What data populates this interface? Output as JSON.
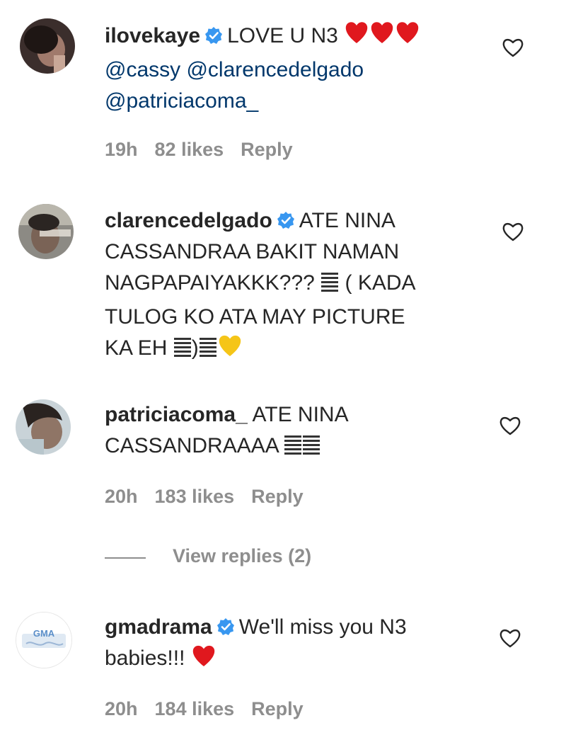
{
  "comments": [
    {
      "username": "ilovekaye",
      "verified": true,
      "text_line1": "LOVE U N3",
      "mentions_line2": "@cassy @clarencedelgado",
      "mentions_line3": "@patriciacoma_",
      "time": "19h",
      "likes": "82 likes",
      "reply": "Reply",
      "emoji": "hearts"
    },
    {
      "username": "clarencedelgado",
      "verified": true,
      "line1": "ATE NINA",
      "line2": "CASSANDRAA BAKIT NAMAN",
      "line3a": "NAGPAPAIYAKKK???",
      "line3b": "( KADA",
      "line4": "TULOG KO ATA MAY PICTURE",
      "line5a": "KA EH",
      "line5b": ")"
    },
    {
      "username": "patriciacoma_",
      "verified": false,
      "line1": "ATE NINA",
      "line2": "CASSANDRAAAA",
      "time": "20h",
      "likes": "183 likes",
      "reply": "Reply",
      "view_replies": "View replies (2)"
    },
    {
      "username": "gmadrama",
      "verified": true,
      "line1": "We'll miss you N3",
      "line2": "babies!!!",
      "time": "20h",
      "likes": "184 likes",
      "reply": "Reply",
      "avatar_text": "GMA"
    }
  ],
  "icons": {
    "like": "heart-outline-icon",
    "verified": "verified-badge-icon"
  },
  "colors": {
    "verified_blue": "#3897f0",
    "mention": "#00376b",
    "meta_gray": "#8e8e8e",
    "heart_red": "#e0181e",
    "yellow_heart": "#f5c518"
  }
}
